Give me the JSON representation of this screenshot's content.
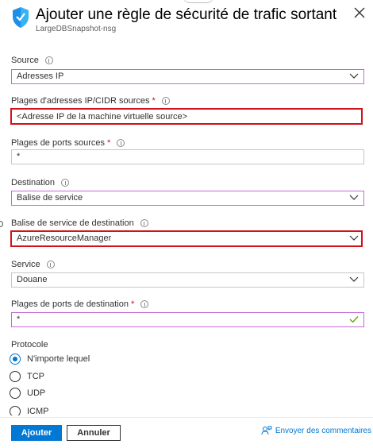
{
  "header": {
    "title": "Ajouter une règle de sécurité de trafic sortant",
    "subtitle": "LargeDBSnapshot-nsg",
    "icon": "shield-icon",
    "close_icon": "close-icon"
  },
  "fields": {
    "source": {
      "label": "Source",
      "value": "Adresses IP"
    },
    "source_ip": {
      "label": "Plages d'adresses IP/CIDR sources",
      "required_mark": "*",
      "value": "<Adresse IP de la machine virtuelle source>"
    },
    "source_ports": {
      "label": "Plages de ports sources",
      "required_mark": "*",
      "value": "*"
    },
    "destination": {
      "label": "Destination",
      "value": "Balise de service"
    },
    "dest_tag": {
      "label": "Balise de service de destination",
      "value": "AzureResourceManager"
    },
    "service": {
      "label": "Service",
      "value": "Douane"
    },
    "dest_ports": {
      "label": "Plages de ports de destination",
      "required_mark": "*",
      "value": "*"
    }
  },
  "protocol": {
    "label": "Protocole",
    "options": [
      {
        "label": "N'importe lequel",
        "checked": true
      },
      {
        "label": "TCP",
        "checked": false
      },
      {
        "label": "UDP",
        "checked": false
      },
      {
        "label": "ICMP",
        "checked": false
      }
    ]
  },
  "footer": {
    "add_label": "Ajouter",
    "cancel_label": "Annuler",
    "feedback_label": "Envoyer des commentaires"
  },
  "colors": {
    "accent": "#0078d4",
    "highlight": "#d1121a",
    "focus_border": "#c36bd6",
    "valid_check": "#57a300"
  }
}
